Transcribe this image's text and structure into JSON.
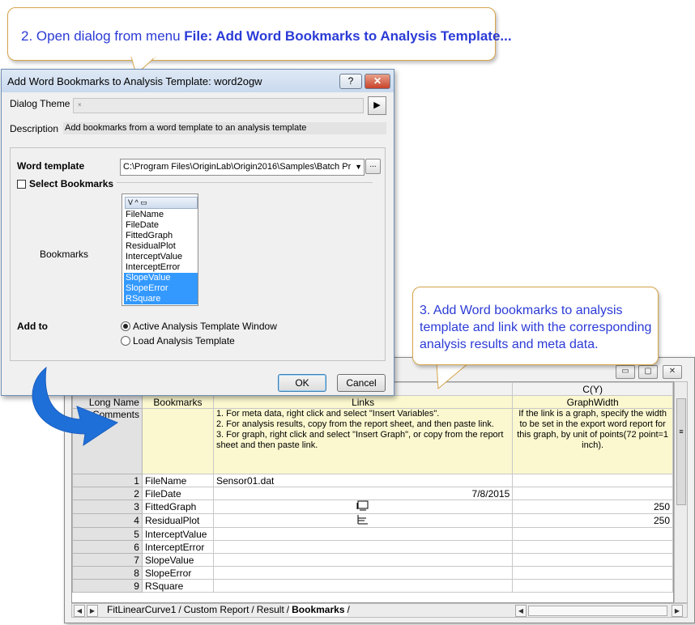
{
  "callouts": {
    "step2_prefix": "2. Open dialog from menu ",
    "step2_menu": "File: Add Word Bookmarks to Analysis Template...",
    "step3_line1": "3. Add Word bookmarks to analysis",
    "step3_line2": "template and link with the corresponding",
    "step3_line3": "analysis results and meta data."
  },
  "dialog": {
    "title": "Add Word Bookmarks to Analysis Template: word2ogw",
    "help_button": "?",
    "close_button": "✕",
    "theme_label": "Dialog Theme",
    "theme_value": "×",
    "theme_arrow": "▶",
    "description_label": "Description",
    "description_value": "Add bookmarks from a word template to an analysis template",
    "word_template_label": "Word template",
    "word_template_value": "C:\\Program Files\\OriginLab\\Origin2016\\Samples\\Batch Pr",
    "combo_arrow": "▼",
    "browse_button": "...",
    "select_bookmarks_label": "Select Bookmarks",
    "bookmarks_label": "Bookmarks",
    "list_toolbar": "V ^ ▭",
    "bookmarks": [
      {
        "name": "FileName",
        "selected": false
      },
      {
        "name": "FileDate",
        "selected": false
      },
      {
        "name": "FittedGraph",
        "selected": false
      },
      {
        "name": "ResidualPlot",
        "selected": false
      },
      {
        "name": "InterceptValue",
        "selected": false
      },
      {
        "name": "InterceptError",
        "selected": false
      },
      {
        "name": "SlopeValue",
        "selected": true
      },
      {
        "name": "SlopeError",
        "selected": true
      },
      {
        "name": "RSquare",
        "selected": true
      }
    ],
    "add_to_label": "Add to",
    "add_to_options": [
      {
        "label": "Active Analysis Template Window",
        "checked": true
      },
      {
        "label": "Load Analysis Template",
        "checked": false
      }
    ],
    "ok_button": "OK",
    "cancel_button": "Cancel"
  },
  "sheet": {
    "window_buttons": [
      "▭",
      "▢",
      "✕"
    ],
    "column_header_c": "C(Y)",
    "long_name_label": "Long Name",
    "comments_label": "Comments",
    "col_a_long_name": "Bookmarks",
    "col_b_long_name": "Links",
    "col_c_long_name": "GraphWidth",
    "col_b_comments": "1. For meta data, right click and select \"Insert Variables\".\n2. For analysis results, copy from the report sheet, and then paste link.\n3. For graph, right click and select \"Insert Graph\", or copy from the report sheet and then paste link.",
    "col_c_comments": "If the link is a graph, specify the width to be set in the export word report for this graph, by unit of points(72 point=1 inch).",
    "rows": [
      {
        "num": "1",
        "a": "FileName",
        "b": "Sensor01.dat",
        "c": ""
      },
      {
        "num": "2",
        "a": "FileDate",
        "b": "7/8/2015",
        "c": ""
      },
      {
        "num": "3",
        "a": "FittedGraph",
        "b": "",
        "c": "250"
      },
      {
        "num": "4",
        "a": "ResidualPlot",
        "b": "",
        "c": "250"
      },
      {
        "num": "5",
        "a": "InterceptValue",
        "b": "",
        "c": ""
      },
      {
        "num": "6",
        "a": "InterceptError",
        "b": "",
        "c": ""
      },
      {
        "num": "7",
        "a": "SlopeValue",
        "b": "",
        "c": ""
      },
      {
        "num": "8",
        "a": "SlopeError",
        "b": "",
        "c": ""
      },
      {
        "num": "9",
        "a": "RSquare",
        "b": "",
        "c": ""
      }
    ],
    "tabs": [
      "FitLinearCurve1",
      "Custom Report",
      "Result",
      "Bookmarks"
    ],
    "active_tab": "Bookmarks",
    "vscroll_marker": "≡"
  },
  "colors": {
    "callout_text": "#2b3bd6",
    "callout_border": "#d6a44a",
    "arrow_blue": "#1f6fd8",
    "comment_fill": "#fbf8cf",
    "selection": "#3399ff"
  }
}
